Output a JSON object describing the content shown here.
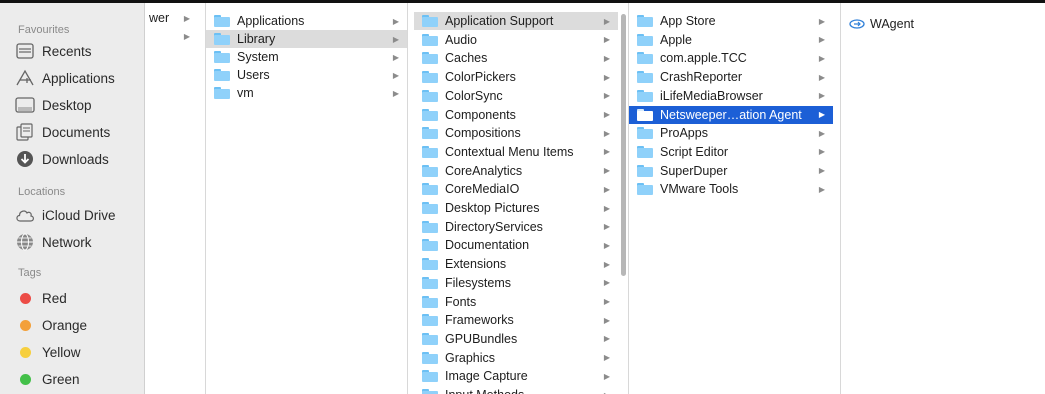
{
  "sidebar": {
    "favourites_header": "Favourites",
    "favourites": [
      {
        "label": "Recents",
        "icon": "recents-icon"
      },
      {
        "label": "Applications",
        "icon": "applications-icon"
      },
      {
        "label": "Desktop",
        "icon": "desktop-icon"
      },
      {
        "label": "Documents",
        "icon": "documents-icon"
      },
      {
        "label": "Downloads",
        "icon": "downloads-icon"
      }
    ],
    "locations_header": "Locations",
    "locations": [
      {
        "label": "iCloud Drive",
        "icon": "cloud-icon"
      },
      {
        "label": "Network",
        "icon": "network-icon"
      }
    ],
    "tags_header": "Tags",
    "tags": [
      {
        "label": "Red",
        "color": "#ec4c46"
      },
      {
        "label": "Orange",
        "color": "#f3a03a"
      },
      {
        "label": "Yellow",
        "color": "#f6cf3e"
      },
      {
        "label": "Green",
        "color": "#43c049"
      }
    ]
  },
  "columns": {
    "col0": {
      "items": [
        {
          "label": "wer",
          "arrow": true
        },
        {
          "label": "",
          "arrow": true
        }
      ]
    },
    "col1": {
      "items": [
        {
          "label": "Applications",
          "arrow": true,
          "icon": "applications-folder-icon"
        },
        {
          "label": "Library",
          "arrow": true,
          "icon": "library-folder-icon",
          "selected": "gray"
        },
        {
          "label": "System",
          "arrow": true,
          "icon": "system-folder-icon"
        },
        {
          "label": "Users",
          "arrow": true,
          "icon": "users-folder-icon"
        },
        {
          "label": "vm",
          "arrow": true,
          "icon": "folder-icon"
        }
      ]
    },
    "col2": {
      "items": [
        {
          "label": "Application Support",
          "arrow": true,
          "selected": "gray"
        },
        {
          "label": "Audio",
          "arrow": true
        },
        {
          "label": "Caches",
          "arrow": true
        },
        {
          "label": "ColorPickers",
          "arrow": true
        },
        {
          "label": "ColorSync",
          "arrow": true
        },
        {
          "label": "Components",
          "arrow": true
        },
        {
          "label": "Compositions",
          "arrow": true
        },
        {
          "label": "Contextual Menu Items",
          "arrow": true
        },
        {
          "label": "CoreAnalytics",
          "arrow": true
        },
        {
          "label": "CoreMediaIO",
          "arrow": true
        },
        {
          "label": "Desktop Pictures",
          "arrow": true
        },
        {
          "label": "DirectoryServices",
          "arrow": true
        },
        {
          "label": "Documentation",
          "arrow": true
        },
        {
          "label": "Extensions",
          "arrow": true
        },
        {
          "label": "Filesystems",
          "arrow": true
        },
        {
          "label": "Fonts",
          "arrow": true
        },
        {
          "label": "Frameworks",
          "arrow": true
        },
        {
          "label": "GPUBundles",
          "arrow": true
        },
        {
          "label": "Graphics",
          "arrow": true
        },
        {
          "label": "Image Capture",
          "arrow": true
        },
        {
          "label": "Input Methods",
          "arrow": true
        }
      ]
    },
    "col3": {
      "items": [
        {
          "label": "App Store",
          "arrow": true
        },
        {
          "label": "Apple",
          "arrow": true
        },
        {
          "label": "com.apple.TCC",
          "arrow": true
        },
        {
          "label": "CrashReporter",
          "arrow": true
        },
        {
          "label": "iLifeMediaBrowser",
          "arrow": true
        },
        {
          "label": "Netsweeper…ation Agent",
          "arrow": true,
          "selected": "blue"
        },
        {
          "label": "ProApps",
          "arrow": true
        },
        {
          "label": "Script Editor",
          "arrow": true
        },
        {
          "label": "SuperDuper",
          "arrow": true
        },
        {
          "label": "VMware Tools",
          "arrow": true
        }
      ]
    },
    "col4": {
      "items": [
        {
          "label": "WAgent",
          "arrow": false,
          "icon": "alias-icon"
        }
      ]
    }
  },
  "colors": {
    "selection_blue": "#1c5fd6",
    "selection_gray": "#dcdcdc",
    "folder_blue": "#8fd1fa"
  }
}
